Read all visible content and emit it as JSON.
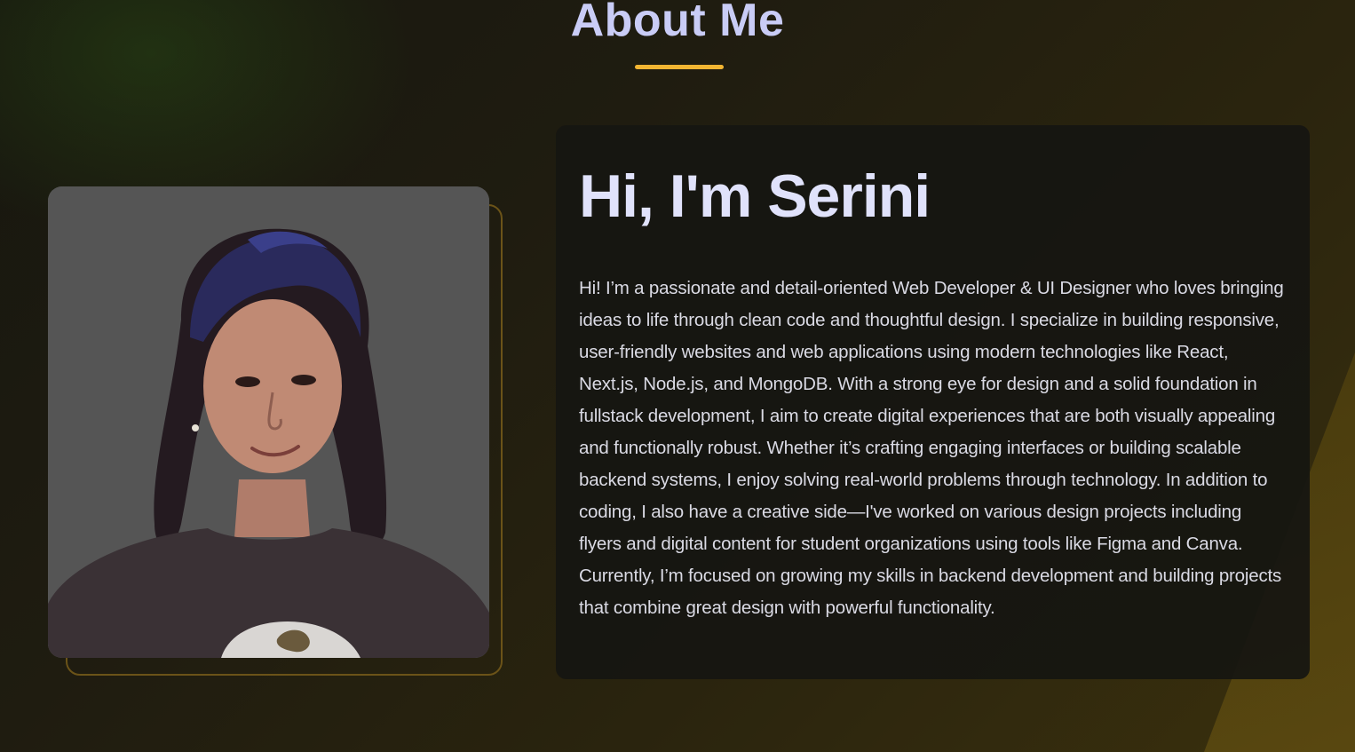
{
  "section": {
    "title": "About Me",
    "accent_color": "#f2b532",
    "title_color": "#c9ccf6"
  },
  "profile": {
    "photo_background": "#555555",
    "greeting": "Hi, I'm Serini",
    "bio": "Hi! I’m a passionate and detail-oriented Web Developer & UI Designer who loves bringing ideas to life through clean code and thoughtful design. I specialize in building responsive, user-friendly websites and web applications using modern technologies like React, Next.js, Node.js, and MongoDB. With a strong eye for design and a solid foundation in fullstack development, I aim to create digital experiences that are both visually appealing and functionally robust. Whether it’s crafting engaging interfaces or building scalable backend systems, I enjoy solving real-world problems through technology. In addition to coding, I also have a creative side—I've worked on various design projects including flyers and digital content for student organizations using tools like Figma and Canva. Currently, I’m focused on growing my skills in backend development and building projects that combine great design with powerful functionality."
  }
}
